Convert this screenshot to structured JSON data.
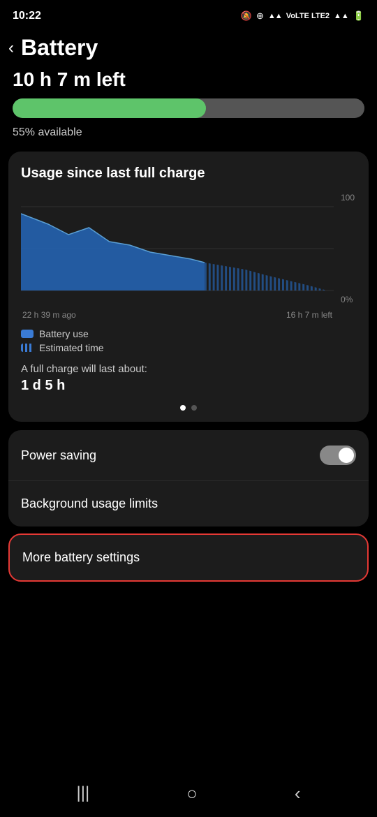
{
  "statusBar": {
    "time": "10:22",
    "icons": "🔕 ⊕ ▲ LTE2 ▲ 🔋"
  },
  "header": {
    "back": "‹",
    "title": "Battery"
  },
  "batteryTimeRemaining": "10 h 7 m left",
  "batteryPercent": 55,
  "batteryPercentLabel": "55% available",
  "usageCard": {
    "title": "Usage since last full charge",
    "chartLeftLabel": "22 h 39 m ago",
    "chartRightLabel": "16 h 7 m left",
    "chartTopLabel": "100",
    "chartBottomLabel": "0%",
    "legend": [
      {
        "label": "Battery use",
        "type": "solid"
      },
      {
        "label": "Estimated time",
        "type": "stripe"
      }
    ],
    "fullChargeLabel": "A full charge will last about:",
    "fullChargeValue": "1 d 5 h",
    "dots": [
      {
        "active": true
      },
      {
        "active": false
      }
    ]
  },
  "settings": [
    {
      "label": "Power saving",
      "toggle": true
    },
    {
      "label": "Background usage limits",
      "toggle": false
    }
  ],
  "moreSettings": {
    "label": "More battery settings"
  },
  "bottomNav": {
    "icons": [
      "|||",
      "○",
      "‹"
    ]
  }
}
